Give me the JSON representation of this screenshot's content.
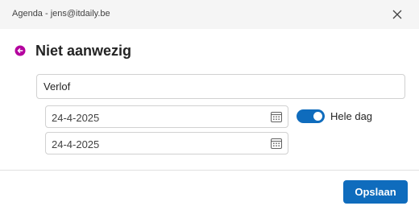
{
  "window": {
    "title": "Agenda - jens@itdaily.be",
    "close_icon": "close-icon"
  },
  "header": {
    "status_icon": "out-of-office-icon",
    "status_color": "#b4009e",
    "title": "Niet aanwezig"
  },
  "form": {
    "subject_value": "Verlof",
    "start_date": "24-4-2025",
    "end_date": "24-4-2025",
    "calendar_icon": "calendar-icon",
    "all_day_label": "Hele dag",
    "all_day_on": true
  },
  "footer": {
    "save_label": "Opslaan"
  },
  "colors": {
    "accent": "#0f6cbd",
    "titlebar_bg": "#f5f5f5"
  }
}
